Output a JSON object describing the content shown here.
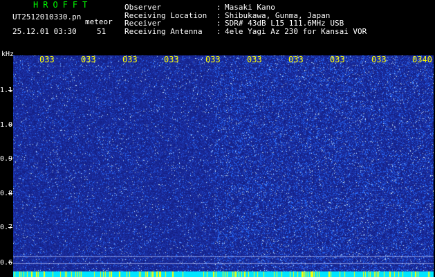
{
  "header": {
    "title": "HROFFT",
    "file_name": "UT2512010330.pn",
    "meteor_label": "meteor",
    "datetime": "25.12.01 03:30",
    "meteor_count": "51"
  },
  "station_info": [
    {
      "label": "Observer",
      "sep": ":",
      "value": "Masaki Kano"
    },
    {
      "label": "Receiving Location",
      "sep": ":",
      "value": "Shibukawa, Gunma, Japan"
    },
    {
      "label": "Receiver",
      "sep": ":",
      "value": "SDR# 43dB L15 111.6MHz USB"
    },
    {
      "label": "Receiving Antenna",
      "sep": ":",
      "value": "4ele Yagi Az 230 for Kansai VOR"
    }
  ],
  "axes": {
    "y_unit": "kHz",
    "y_ticks": [
      "1.1",
      "1.0",
      "0.9",
      "0.8",
      "0.7",
      "0.6"
    ],
    "x_ticks": [
      "033",
      "033",
      "033",
      "033",
      "033",
      "033",
      "033",
      "033",
      "033",
      "0340"
    ]
  },
  "colors": {
    "background": "#000000",
    "title": "#00ff00",
    "text": "#ffffff",
    "time_ticks": "#ffff00",
    "noise_base": "#1d2a9c",
    "noise_bright": "#3a6cff",
    "sparkle": "#c8e6ff",
    "bottom_band": "#00e5ff"
  }
}
